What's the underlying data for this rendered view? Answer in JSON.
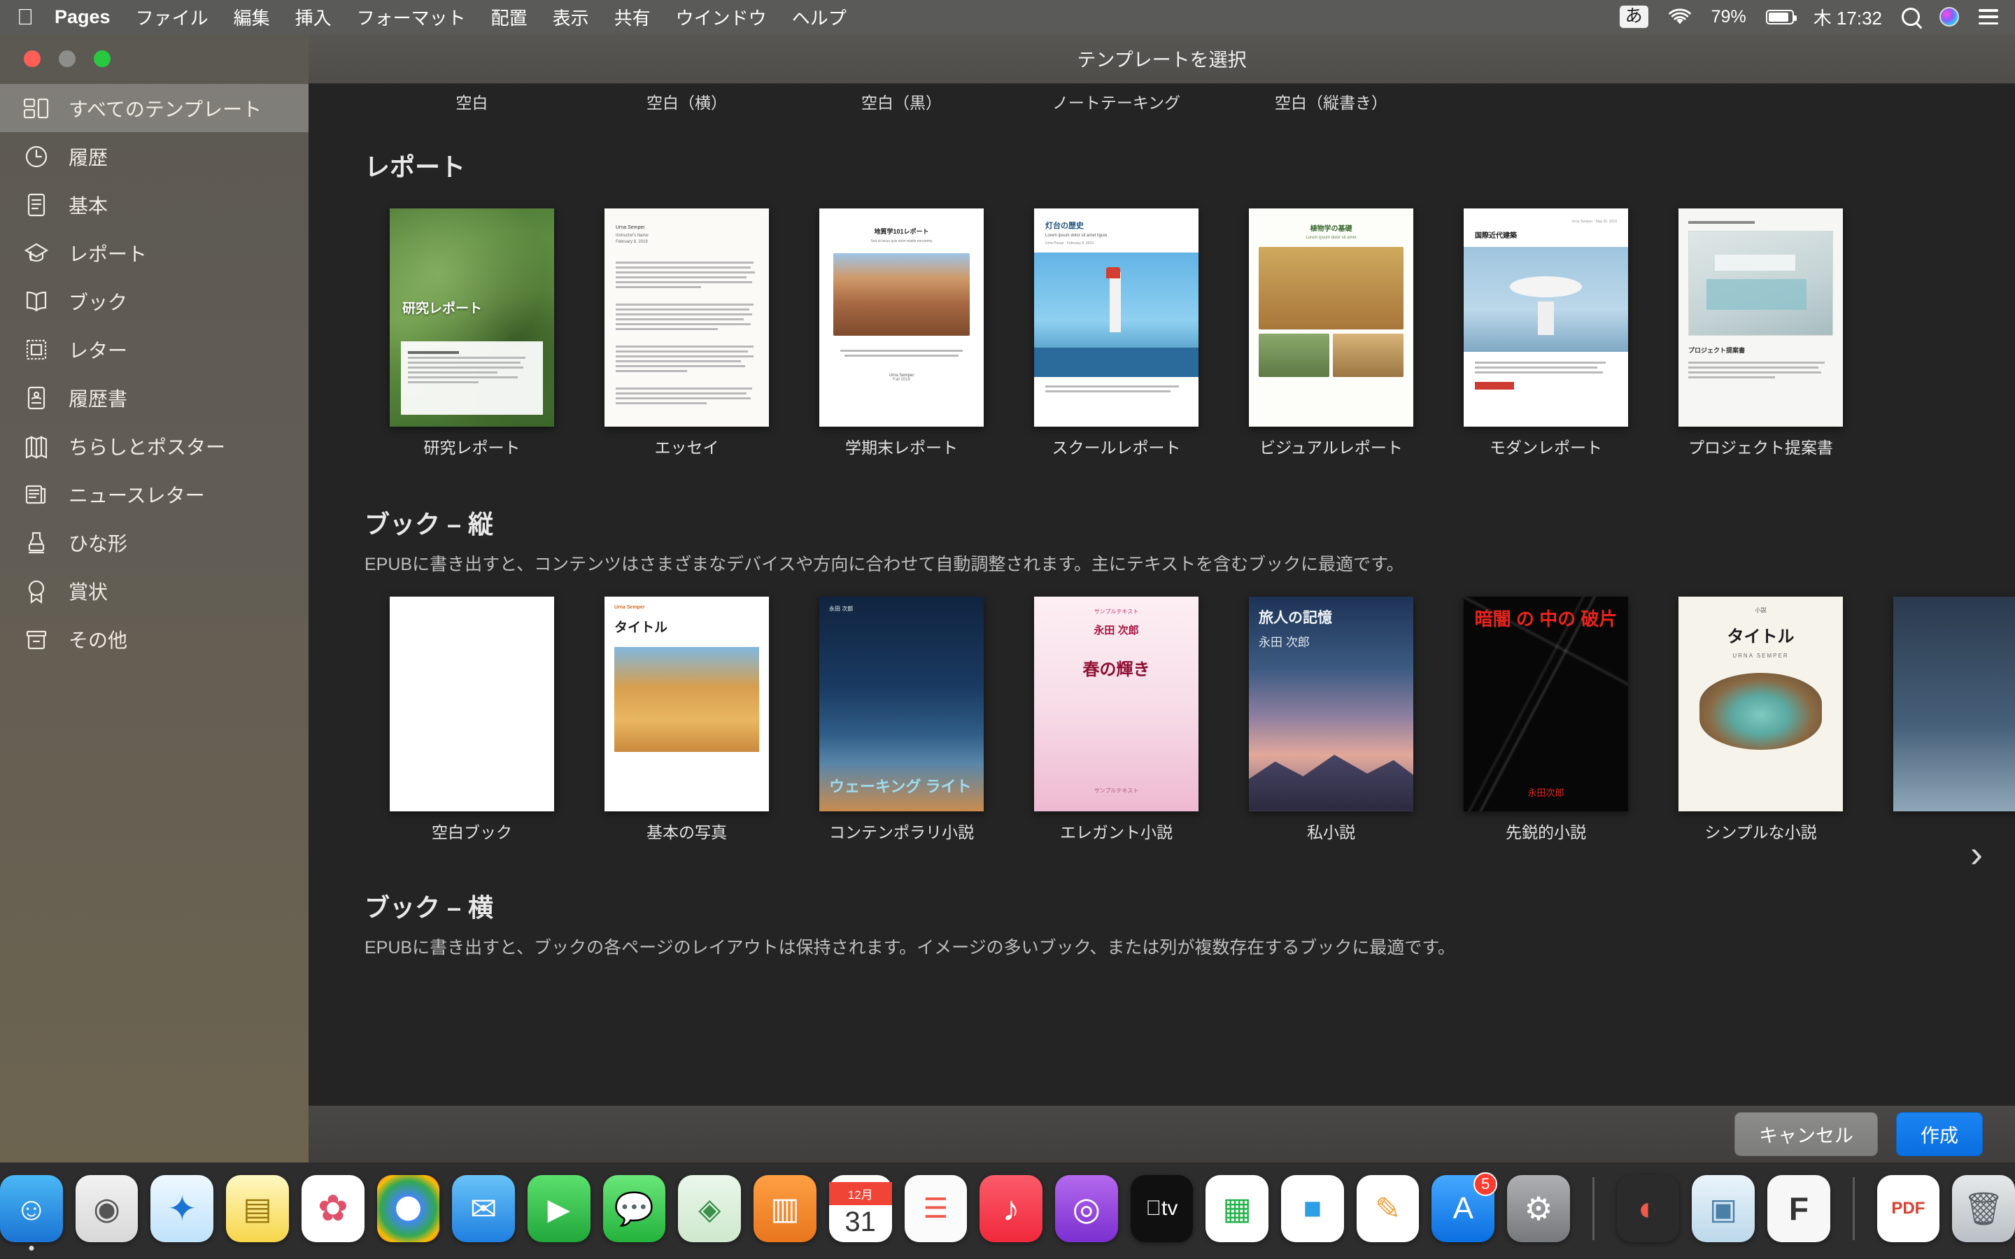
{
  "menubar": {
    "apple_icon": "apple-logo-icon",
    "app_name": "Pages",
    "items": [
      "ファイル",
      "編集",
      "挿入",
      "フォーマット",
      "配置",
      "表示",
      "共有",
      "ウインドウ",
      "ヘルプ"
    ],
    "status": {
      "input_source": "あ",
      "wifi_icon": "wifi-icon",
      "battery_percent": "79%",
      "clock": "木 17:32",
      "search_icon": "search-icon",
      "siri_icon": "siri-icon",
      "control_center_icon": "control-center-icon"
    }
  },
  "window": {
    "title": "テンプレートを選択"
  },
  "sidebar": {
    "items": [
      {
        "label": "すべてのテンプレート",
        "icon": "grid-icon",
        "active": true
      },
      {
        "label": "履歴",
        "icon": "clock-icon",
        "active": false
      },
      {
        "label": "基本",
        "icon": "document-icon",
        "active": false
      },
      {
        "label": "レポート",
        "icon": "graduation-cap-icon",
        "active": false
      },
      {
        "label": "ブック",
        "icon": "open-book-icon",
        "active": false
      },
      {
        "label": "レター",
        "icon": "stamp-letter-icon",
        "active": false
      },
      {
        "label": "履歴書",
        "icon": "resume-icon",
        "active": false
      },
      {
        "label": "ちらしとポスター",
        "icon": "folded-flyer-icon",
        "active": false
      },
      {
        "label": "ニュースレター",
        "icon": "newspaper-icon",
        "active": false
      },
      {
        "label": "ひな形",
        "icon": "rubber-stamp-icon",
        "active": false
      },
      {
        "label": "賞状",
        "icon": "award-ribbon-icon",
        "active": false
      },
      {
        "label": "その他",
        "icon": "box-icon",
        "active": false
      }
    ]
  },
  "main": {
    "partial_top_row_labels": [
      "空白",
      "空白（横）",
      "空白（黒）",
      "ノートテーキング",
      "空白（縦書き）"
    ],
    "sections": [
      {
        "heading": "レポート",
        "description": "",
        "templates": [
          {
            "name": "研究レポート"
          },
          {
            "name": "エッセイ"
          },
          {
            "name": "学期末レポート"
          },
          {
            "name": "スクールレポート"
          },
          {
            "name": "ビジュアルレポート"
          },
          {
            "name": "モダンレポート"
          },
          {
            "name": "プロジェクト提案書"
          }
        ]
      },
      {
        "heading": "ブック – 縦",
        "description": "EPUBに書き出すと、コンテンツはさまざまなデバイスや方向に合わせて自動調整されます。主にテキストを含むブックに最適です。",
        "templates": [
          {
            "name": "空白ブック"
          },
          {
            "name": "基本の写真"
          },
          {
            "name": "コンテンポラリ小説"
          },
          {
            "name": "エレガント小説"
          },
          {
            "name": "私小説"
          },
          {
            "name": "先鋭的小説"
          },
          {
            "name": "シンプルな小説"
          }
        ]
      },
      {
        "heading": "ブック – 横",
        "description": "EPUBに書き出すと、ブックの各ページのレイアウトは保持されます。イメージの多いブック、または列が複数存在するブックに最適です。",
        "templates": []
      }
    ],
    "next_arrow_icon": "chevron-right-icon"
  },
  "thumbnail_text": {
    "research_report": {
      "title": "研究レポート"
    },
    "essay": {
      "author": "Urna Semper",
      "sub": "Instructor's Name",
      "date": "February 8, 2019"
    },
    "term_report": {
      "title": "地質学101レポート",
      "sub": "Sed ut lacus quis enim mattis nonummy",
      "author": "Urna Semper",
      "date": "Fall 2019"
    },
    "school_report": {
      "title": "灯台の歴史",
      "sub": "Lorem ipsum dolor sit amet ligula",
      "byline": "Urna Posue · February 8, 2019"
    },
    "visual_report": {
      "title": "植物学の基礎",
      "sub": "Lorem ipsum dolor sit amet"
    },
    "modern_report": {
      "title": "国際近代建築",
      "meta": "Urna Semper · May 30, 2019"
    },
    "project_proposal": {
      "title": "プロジェクト提案書"
    },
    "blank_book": {
      "title": ""
    },
    "basic_photo": {
      "author": "Urna Semper",
      "title": "タイトル"
    },
    "contemporary": {
      "author": "永田 次郎",
      "title": "ウェーキング ライト"
    },
    "elegant": {
      "top": "サンプルテキスト",
      "author": "永田 次郎",
      "title": "春の輝き",
      "bottom": "サンプルテキスト"
    },
    "personal": {
      "title": "旅人の記憶",
      "author": "永田 次郎"
    },
    "edgy": {
      "title": "暗闇 の 中の 破片",
      "author": "永田次郎"
    },
    "simple": {
      "kind": "小説",
      "title": "タイトル",
      "author": "URNA SEMPER"
    }
  },
  "footer": {
    "cancel_label": "キャンセル",
    "create_label": "作成"
  },
  "dock": {
    "items": [
      {
        "name": "finder",
        "label": "Finder",
        "color": "#2a9df4",
        "glyph": "☺"
      },
      {
        "name": "launchpad",
        "label": "Launchpad",
        "color": "#d8d8d8",
        "glyph": "◉"
      },
      {
        "name": "safari",
        "label": "Safari",
        "color": "#e8f4fd",
        "glyph": "🧭"
      },
      {
        "name": "notes",
        "label": "メモ",
        "color": "#fdf3c2",
        "glyph": "▤"
      },
      {
        "name": "photos",
        "label": "写真",
        "color": "#fafafa",
        "glyph": "✿"
      },
      {
        "name": "chrome",
        "label": "Chrome",
        "color": "#f6f6f6",
        "glyph": "◍"
      },
      {
        "name": "mail",
        "label": "メール",
        "color": "#4a90e2",
        "glyph": "✉"
      },
      {
        "name": "facetime",
        "label": "FaceTime",
        "color": "#36c24a",
        "glyph": "📹"
      },
      {
        "name": "messages",
        "label": "メッセージ",
        "color": "#3ecf4c",
        "glyph": "💬"
      },
      {
        "name": "maps",
        "label": "マップ",
        "color": "#eaf6e9",
        "glyph": "◈"
      },
      {
        "name": "books",
        "label": "ブック",
        "color": "#e8761e",
        "glyph": "▥"
      },
      {
        "name": "calendar",
        "label": "カレンダー",
        "color": "#ffffff",
        "glyph": "31",
        "badge_top": "12月"
      },
      {
        "name": "reminders",
        "label": "リマインダー",
        "color": "#fbfbfb",
        "glyph": "☰"
      },
      {
        "name": "music",
        "label": "ミュージック",
        "color": "#fc3c44",
        "glyph": "♪"
      },
      {
        "name": "podcasts",
        "label": "Podcast",
        "color": "#9146d8",
        "glyph": "◎"
      },
      {
        "name": "appletv",
        "label": "Apple TV",
        "color": "#111111",
        "glyph": "tv"
      },
      {
        "name": "numbers",
        "label": "Numbers",
        "color": "#21b34a",
        "glyph": "▮"
      },
      {
        "name": "keynote",
        "label": "Keynote",
        "color": "#2e9fe5",
        "glyph": "◼"
      },
      {
        "name": "pages",
        "label": "Pages",
        "color": "#f2a03d",
        "glyph": "✎"
      },
      {
        "name": "appstore",
        "label": "App Store",
        "color": "#1f8af5",
        "glyph": "A",
        "badge": "5"
      },
      {
        "name": "systempreferences",
        "label": "システム環境設定",
        "color": "#8e8e93",
        "glyph": "⚙"
      },
      {
        "name": "activitymonitor",
        "label": "アクティビティモニタ",
        "color": "#2b2b2b",
        "glyph": "◕"
      },
      {
        "name": "preview",
        "label": "プレビュー",
        "color": "#dcecf7",
        "glyph": "🖼"
      },
      {
        "name": "fontbook",
        "label": "Font Book",
        "color": "#f5f5f5",
        "glyph": "F"
      },
      {
        "name": "pdf-document",
        "label": "PDF書類",
        "color": "#ffffff",
        "glyph": "PDF"
      },
      {
        "name": "trash",
        "label": "ゴミ箱",
        "color": "#cfd3d6",
        "glyph": "🗑"
      }
    ]
  },
  "colors": {
    "accent_blue": "#0a6fe0",
    "menubar_bg": "#5a5a58",
    "sidebar_bg": "#625d54",
    "content_bg": "#242424",
    "titlebar_bg": "#565450"
  }
}
